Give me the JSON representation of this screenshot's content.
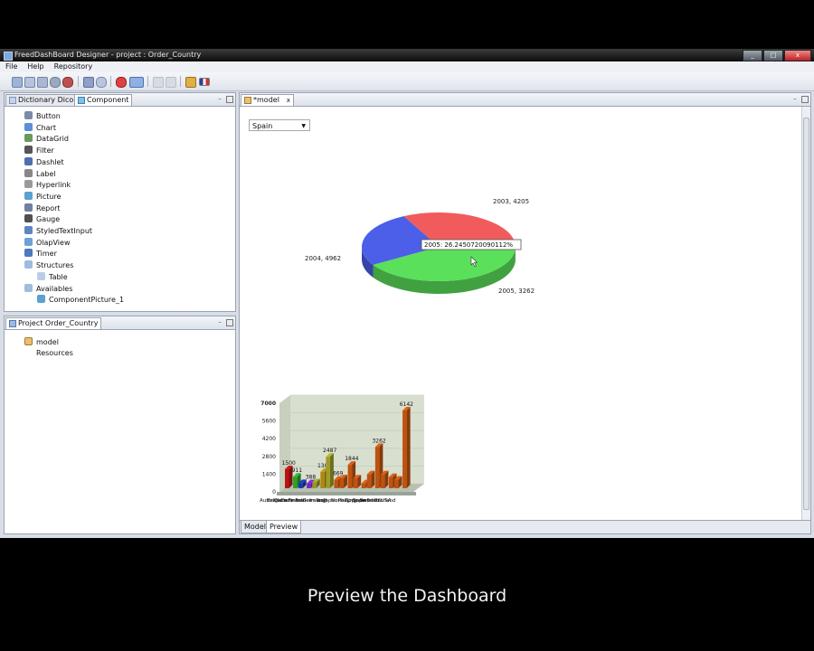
{
  "window": {
    "title": "FreedDashBoard Designer - project : Order_Country"
  },
  "menu": [
    "File",
    "Help",
    "Repository"
  ],
  "left_top_panel": {
    "tabs": [
      "Dictionary Dico",
      "Component"
    ],
    "items": [
      {
        "label": "Button",
        "icon": "button-icon"
      },
      {
        "label": "Chart",
        "icon": "chart-icon"
      },
      {
        "label": "DataGrid",
        "icon": "datagrid-icon"
      },
      {
        "label": "Filter",
        "icon": "filter-icon"
      },
      {
        "label": "Dashlet",
        "icon": "dashlet-icon"
      },
      {
        "label": "Label",
        "icon": "label-icon"
      },
      {
        "label": "Hyperlink",
        "icon": "hyperlink-icon"
      },
      {
        "label": "Picture",
        "icon": "picture-icon"
      },
      {
        "label": "Report",
        "icon": "report-icon"
      },
      {
        "label": "Gauge",
        "icon": "gauge-icon"
      },
      {
        "label": "StyledTextInput",
        "icon": "textinput-icon"
      },
      {
        "label": "OlapView",
        "icon": "olapview-icon"
      },
      {
        "label": "Timer",
        "icon": "timer-icon"
      },
      {
        "label": "Structures",
        "icon": "folder-icon"
      },
      {
        "label": "Table",
        "icon": "table-icon"
      },
      {
        "label": "Availables",
        "icon": "folder-icon"
      },
      {
        "label": "ComponentPicture_1",
        "icon": "picture-icon"
      }
    ]
  },
  "left_bottom_panel": {
    "tab": "Project Order_Country",
    "items": [
      {
        "label": "model",
        "icon": "model-icon"
      },
      {
        "label": "Resources",
        "icon": ""
      }
    ]
  },
  "editor": {
    "tab": "*model",
    "bottom_tabs": [
      "Model",
      "Preview"
    ],
    "country_select": "Spain"
  },
  "chart_data": [
    {
      "type": "pie",
      "labels": [
        "2003",
        "2004",
        "2005"
      ],
      "values": [
        4205,
        4962,
        3262
      ],
      "colors": [
        "#f25b5b",
        "#5ae05a",
        "#4b5fe8"
      ],
      "slice_labels": [
        "2003, 4205",
        "2004, 4962",
        "2005, 3262"
      ],
      "tooltip": "2005: 26.2450720090112%"
    },
    {
      "type": "bar",
      "ytick_labels": [
        "0",
        "1400",
        "2800",
        "4200",
        "5600",
        "7000"
      ],
      "ylim": [
        0,
        7000
      ],
      "categories": [
        "Australia",
        "Belgium",
        "Canada",
        "Denmark",
        "Finland",
        "France",
        "Germany",
        "Ireland",
        "Italy",
        "Japan",
        "Norway",
        "Philippines",
        "Singapore",
        "Spain",
        "Sweden",
        "Switzerland",
        "UK",
        "USA"
      ],
      "values": [
        1500,
        911,
        400,
        388,
        460,
        1300,
        2487,
        669,
        790,
        1844,
        780,
        380,
        1100,
        3262,
        1100,
        880,
        675,
        6142
      ],
      "value_labels": [
        "1500",
        "911",
        "",
        "388",
        "",
        "1300",
        "2487",
        "669",
        "",
        "1844",
        "",
        "",
        "",
        "3262",
        "",
        "",
        "",
        "6142"
      ],
      "colors": [
        "#d81818",
        "#2fbf2f",
        "#1f3fc8",
        "#8a2be2",
        "#b0b030",
        "#c8a010",
        "#b8b830",
        "#e06010",
        "#e06010",
        "#e06010",
        "#e06010",
        "#e06010",
        "#e06010",
        "#e06010",
        "#e06010",
        "#e06010",
        "#e06010",
        "#e06010"
      ]
    }
  ],
  "caption": "Preview the Dashboard"
}
